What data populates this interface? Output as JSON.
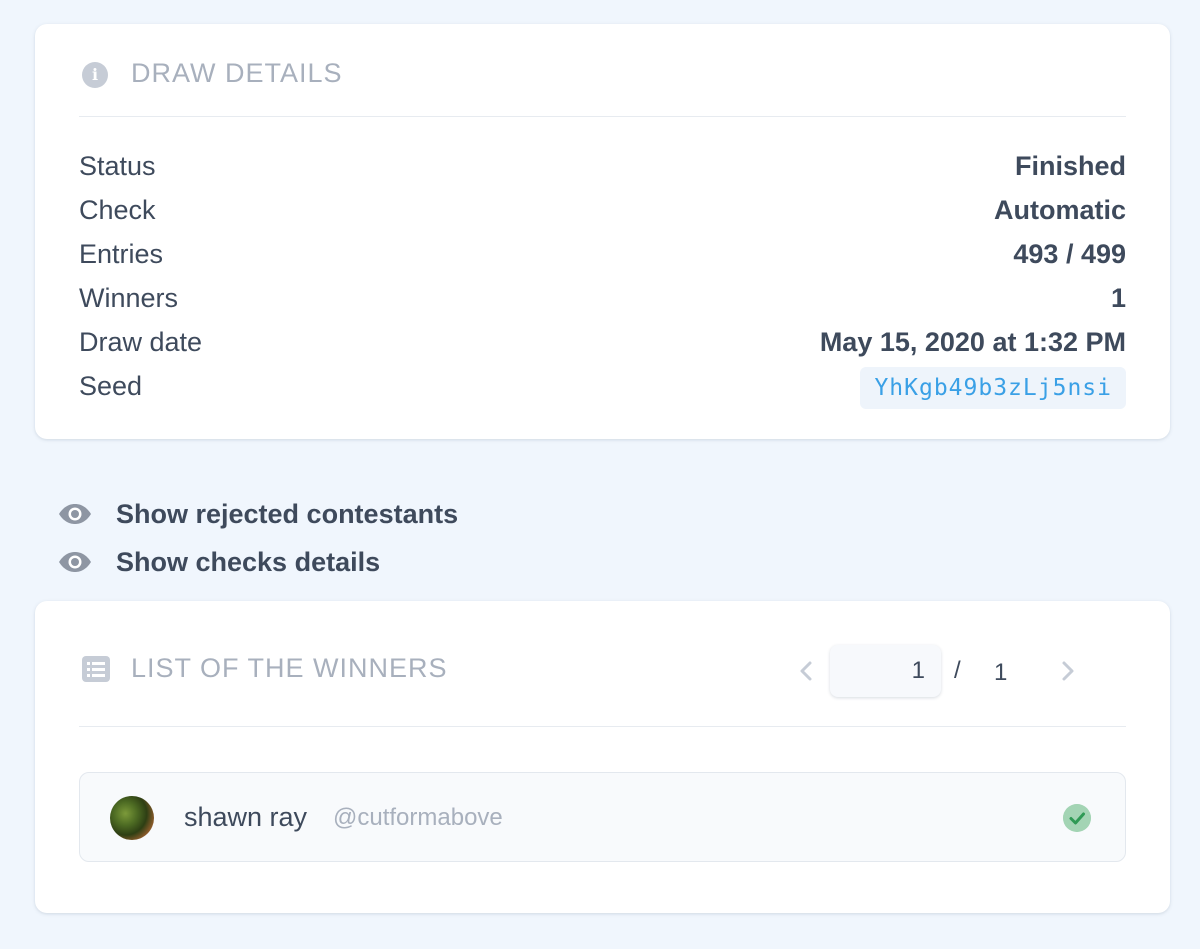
{
  "details": {
    "title": "DRAW DETAILS",
    "icon": "info-icon",
    "rows": [
      {
        "label": "Status",
        "value": "Finished"
      },
      {
        "label": "Check",
        "value": "Automatic"
      },
      {
        "label": "Entries",
        "value": "493 / 499"
      },
      {
        "label": "Winners",
        "value": "1"
      },
      {
        "label": "Draw date",
        "value": "May 15, 2020 at 1:32 PM"
      }
    ],
    "seed_label": "Seed",
    "seed_value": "YhKgb49b3zLj5nsi"
  },
  "toggles": {
    "rejected_label": "Show rejected contestants",
    "checks_label": "Show checks details",
    "icon": "eye-icon"
  },
  "winners": {
    "title": "LIST OF THE WINNERS",
    "icon": "list-icon",
    "pager": {
      "current": "1",
      "separator": "/",
      "total": "1"
    },
    "items": [
      {
        "name": "shawn ray",
        "handle": "@cutformabove",
        "status": "checked"
      }
    ]
  },
  "colors": {
    "background": "#f0f6fd",
    "card": "#ffffff",
    "muted_text": "#a8b0bd",
    "text": "#3e4a5c",
    "seed_text": "#3aa0e6",
    "check_badge": "#a3d4b4",
    "check_mark": "#2f9a55"
  }
}
